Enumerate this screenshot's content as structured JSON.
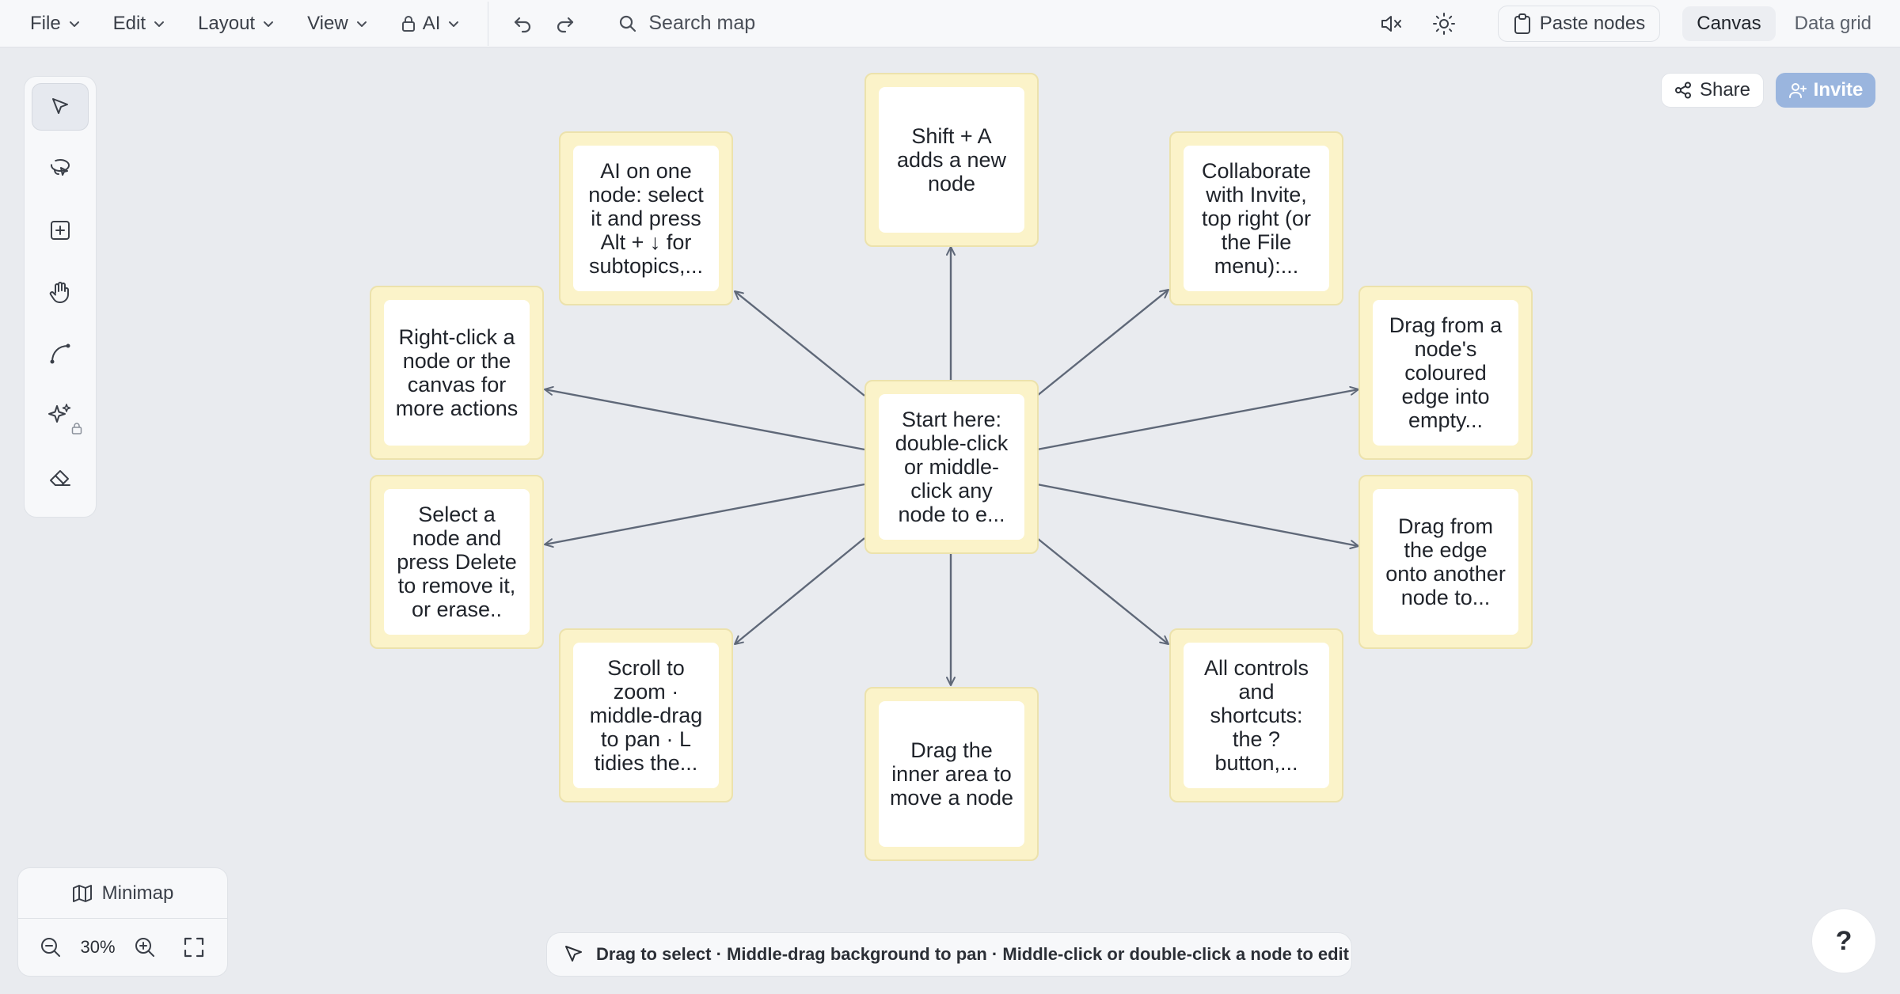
{
  "menubar": {
    "file": "File",
    "edit": "Edit",
    "layout": "Layout",
    "view": "View",
    "ai": "AI",
    "search_placeholder": "Search map",
    "paste_nodes": "Paste nodes",
    "view_tabs": [
      "Canvas",
      "Data grid"
    ],
    "active_view": "Canvas"
  },
  "toolbar": {
    "tools": [
      "select-tool",
      "lasso-tool",
      "add-node-tool",
      "pan-tool",
      "connector-tool",
      "ai-tool",
      "eraser-tool"
    ],
    "active": "select-tool"
  },
  "header_actions": {
    "share": "Share",
    "invite": "Invite"
  },
  "nodes": {
    "center": "Start here: double-click or middle-click any node to e...",
    "top": "Shift + A adds a new node",
    "top_left": "AI on one node: select it and press Alt + ↓ for subtopics,...",
    "top_right": "Collaborate with Invite, top right (or the File menu):...",
    "left_upper": "Right-click a node or the canvas for more actions",
    "right_upper": "Drag from a node's coloured edge into empty...",
    "left_lower": "Select a node and press Delete to remove it, or erase..",
    "right_lower": "Drag from the edge onto another node to...",
    "bottom_left": "Scroll to zoom · middle-drag to pan · L tidies the...",
    "bottom_right": "All controls and shortcuts: the ? button,...",
    "bottom": "Drag the inner area to move a node"
  },
  "minimap": {
    "label": "Minimap",
    "zoom": "30%"
  },
  "hint": "Drag to select · Middle-drag background to pan · Middle-click or double-click a node to edit",
  "help": "?",
  "colors": {
    "node_fill": "#fbf3c9",
    "node_border": "#ece2ac",
    "edge": "#5f6878",
    "invite_bg": "#9ab5de"
  }
}
